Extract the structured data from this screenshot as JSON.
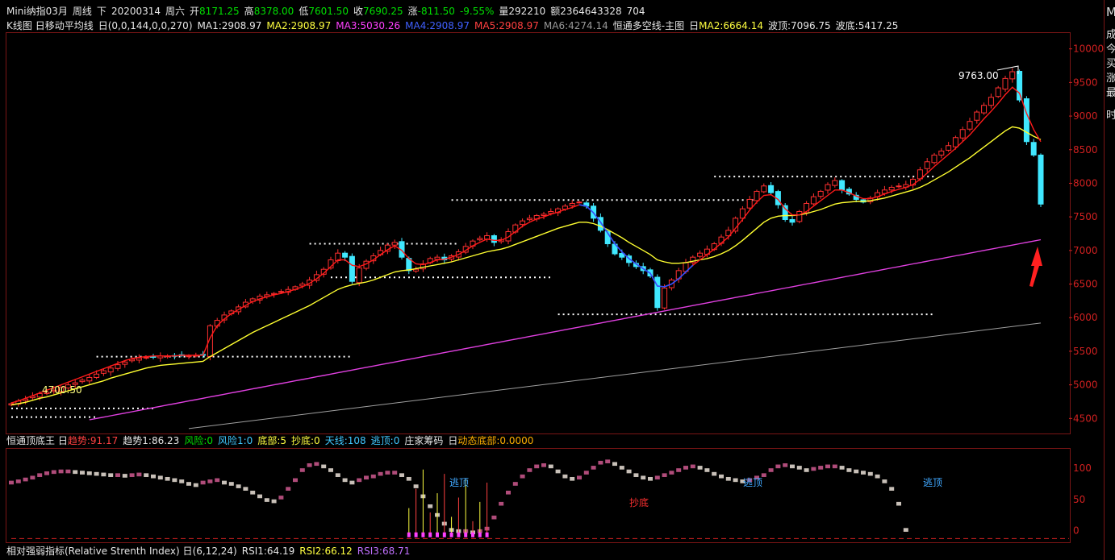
{
  "header": {
    "symbol": "Mini纳指03月",
    "period": "周线",
    "direction": "下",
    "date": "20200314",
    "weekday": "周六",
    "open_label": "开",
    "open": "8171.25",
    "high_label": "高",
    "high": "8378.00",
    "low_label": "低",
    "low": "7601.50",
    "close_label": "收",
    "close": "7690.25",
    "chg_label": "涨",
    "chg": "-811.50",
    "chg_pct": "-9.55%",
    "vol_label": "量",
    "vol": "292210",
    "amt_label": "额",
    "amt": "2364643328",
    "extra": "704"
  },
  "ma_bar": {
    "k_label": "K线图",
    "ma_name": "日移动平均线",
    "ma_params": "日(0,0,144,0,0,270)",
    "ma1": "MA1:2908.97",
    "ma2": "MA2:2908.97",
    "ma3": "MA3:5030.26",
    "ma4": "MA4:2908.97",
    "ma5": "MA5:2908.97",
    "ma6": "MA6:4274.14",
    "hengtong": "恒通多空线-主图",
    "hengtong_box": "日",
    "ma2b": "MA2:6664.14",
    "bo_top": "波顶:7096.75",
    "bo_bottom": "波底:5417.25"
  },
  "ind_bar": {
    "name": "恒通顶底王",
    "box": "日",
    "trend": "趋势:91.17",
    "trend1": "趋势1:86.23",
    "risk": "风险:0",
    "risk1": "风险1:0",
    "bottom": "底部:5",
    "chaodi": "抄底:0",
    "tianxian": "天线:108",
    "taoding": "逃顶:0",
    "zhuangjia": "庄家筹码",
    "zj_box": "日",
    "dongtai": "动态底部:0.0000"
  },
  "rsi_bar": {
    "name": "相对强弱指标(Relative Strenth Index)",
    "box": "日",
    "params": "(6,12,24)",
    "rsi1": "RSI1:64.19",
    "rsi2": "RSI2:66.12",
    "rsi3": "RSI3:68.71"
  },
  "right_panel": {
    "c0": "M",
    "c1": "成",
    "c2": "今",
    "c3": "买",
    "c4": "涨",
    "c5": "最",
    "c6": "时"
  },
  "annotations": {
    "peak": "9763.00",
    "start": "4700.50",
    "taoding1": "逃顶",
    "taoding2": "逃顶",
    "taoding3": "逃顶",
    "chaodi_text": "抄底"
  },
  "colors": {
    "up": "#ff3030",
    "down": "#40e8ff",
    "ma_red": "#ff1a1a",
    "ma_yellow": "#ffff30",
    "ma_magenta": "#e040e0",
    "ma_gray": "#a0a0a0",
    "ma_green": "#30e030",
    "ma_blue": "#3050ff"
  },
  "chart_data": {
    "type": "candlestick",
    "y_axis_ticks": [
      10000,
      9500,
      9000,
      8500,
      8000,
      7500,
      7000,
      6500,
      6000,
      5500,
      5000,
      4500
    ],
    "ylim": [
      4300,
      10200
    ],
    "ind_ticks": [
      100,
      50,
      0
    ],
    "ind_ylim": [
      -15,
      130
    ],
    "weeks": 130,
    "close": [
      4720,
      4760,
      4790,
      4830,
      4870,
      4890,
      4920,
      4960,
      5000,
      5030,
      5070,
      5110,
      5160,
      5210,
      5250,
      5300,
      5340,
      5380,
      5400,
      5410,
      5420,
      5430,
      5430,
      5430,
      5440,
      5430,
      5440,
      5440,
      5880,
      5960,
      6040,
      6100,
      6160,
      6230,
      6280,
      6320,
      6340,
      6360,
      6390,
      6420,
      6460,
      6500,
      6560,
      6640,
      6720,
      6860,
      6960,
      6900,
      6540,
      6740,
      6840,
      6920,
      7000,
      7080,
      7120,
      6900,
      6700,
      6720,
      6800,
      6880,
      6900,
      6860,
      6920,
      6980,
      7060,
      7140,
      7180,
      7220,
      7120,
      7160,
      7280,
      7380,
      7440,
      7480,
      7520,
      7540,
      7580,
      7620,
      7660,
      7700,
      7720,
      7660,
      7480,
      7300,
      7100,
      6950,
      6900,
      6820,
      6760,
      6700,
      6620,
      6150,
      6440,
      6560,
      6700,
      6820,
      6900,
      6960,
      7020,
      7100,
      7200,
      7300,
      7480,
      7620,
      7760,
      7880,
      7960,
      7860,
      7680,
      7460,
      7420,
      7580,
      7700,
      7800,
      7880,
      7980,
      8040,
      7900,
      7840,
      7760,
      7720,
      7780,
      7860,
      7900,
      7940,
      7960,
      7980,
      8060,
      8200,
      8320,
      8420,
      8480,
      8560,
      8680,
      8800,
      8920,
      9060,
      9160,
      9280,
      9420,
      9560,
      9660,
      9240,
      8620,
      8420,
      7690
    ],
    "ma_red": [
      4730,
      4760,
      4800,
      4840,
      4880,
      4920,
      4960,
      5000,
      5040,
      5080,
      5120,
      5160,
      5200,
      5240,
      5280,
      5320,
      5360,
      5390,
      5410,
      5420,
      5430,
      5430,
      5430,
      5430,
      5440,
      5440,
      5440,
      5440,
      5700,
      5880,
      5980,
      6060,
      6120,
      6180,
      6240,
      6280,
      6310,
      6340,
      6360,
      6390,
      6420,
      6460,
      6510,
      6580,
      6660,
      6760,
      6860,
      6860,
      6780,
      6760,
      6800,
      6860,
      6940,
      7010,
      7070,
      7000,
      6880,
      6800,
      6790,
      6820,
      6860,
      6870,
      6900,
      6940,
      7000,
      7070,
      7120,
      7170,
      7150,
      7150,
      7200,
      7280,
      7360,
      7420,
      7470,
      7500,
      7540,
      7570,
      7610,
      7640,
      7680,
      7660,
      7560,
      7420,
      7260,
      7100,
      6980,
      6880,
      6800,
      6730,
      6660,
      6470,
      6460,
      6500,
      6580,
      6680,
      6780,
      6860,
      6940,
      7020,
      7110,
      7200,
      7330,
      7460,
      7600,
      7720,
      7820,
      7830,
      7760,
      7620,
      7530,
      7530,
      7580,
      7660,
      7740,
      7820,
      7900,
      7900,
      7860,
      7810,
      7770,
      7770,
      7800,
      7840,
      7880,
      7910,
      7940,
      7980,
      8060,
      8150,
      8250,
      8340,
      8430,
      8520,
      8620,
      8720,
      8840,
      8960,
      9070,
      9190,
      9320,
      9430,
      9340,
      9040,
      8800,
      8620
    ],
    "ma_yellow": [
      4700,
      4720,
      4740,
      4770,
      4800,
      4820,
      4850,
      4880,
      4910,
      4940,
      4970,
      5000,
      5030,
      5060,
      5100,
      5130,
      5160,
      5190,
      5220,
      5250,
      5270,
      5290,
      5300,
      5310,
      5320,
      5330,
      5340,
      5350,
      5420,
      5480,
      5540,
      5600,
      5660,
      5720,
      5780,
      5830,
      5880,
      5930,
      5980,
      6030,
      6080,
      6130,
      6180,
      6240,
      6300,
      6360,
      6420,
      6460,
      6490,
      6510,
      6530,
      6560,
      6600,
      6640,
      6680,
      6700,
      6710,
      6730,
      6750,
      6770,
      6790,
      6810,
      6830,
      6860,
      6890,
      6920,
      6950,
      6980,
      7000,
      7020,
      7050,
      7090,
      7130,
      7170,
      7210,
      7250,
      7290,
      7330,
      7360,
      7390,
      7420,
      7420,
      7400,
      7360,
      7310,
      7250,
      7190,
      7120,
      7060,
      7000,
      6940,
      6860,
      6830,
      6810,
      6810,
      6820,
      6840,
      6860,
      6880,
      6910,
      6950,
      7000,
      7070,
      7150,
      7240,
      7330,
      7420,
      7480,
      7510,
      7520,
      7520,
      7530,
      7550,
      7580,
      7610,
      7650,
      7690,
      7710,
      7720,
      7730,
      7730,
      7740,
      7760,
      7780,
      7810,
      7840,
      7870,
      7900,
      7940,
      7990,
      8050,
      8110,
      8170,
      8240,
      8310,
      8380,
      8460,
      8540,
      8620,
      8700,
      8780,
      8840,
      8820,
      8760,
      8700,
      8650
    ],
    "ma_magenta": [
      4480,
      4500,
      4520,
      4540,
      4560,
      4580,
      4600,
      4620,
      4640,
      4660,
      4680,
      4700,
      4720,
      4740,
      4760,
      4780,
      4800,
      4820,
      4840,
      4860,
      4880,
      4900,
      4920,
      4940,
      4960,
      4980,
      5000,
      5020,
      5040,
      5060,
      5080,
      5100,
      5120,
      5140,
      5160,
      5180,
      5200,
      5220,
      5240,
      5260,
      5280,
      5300,
      5320,
      5340,
      5360,
      5380,
      5400,
      5420,
      5440,
      5460,
      5480,
      5500,
      5520,
      5540,
      5560,
      5580,
      5600,
      5620,
      5640,
      5660,
      5680,
      5700,
      5720,
      5740,
      5760,
      5780,
      5800,
      5820,
      5840,
      5860,
      5880,
      5900,
      5920,
      5940,
      5960,
      5980,
      6000,
      6020,
      6040,
      6060,
      6080,
      6100,
      6120,
      6140,
      6160,
      6180,
      6200,
      6220,
      6240,
      6260,
      6280,
      6300,
      6320,
      6340,
      6360,
      6380,
      6400,
      6420,
      6440,
      6460,
      6480,
      6500,
      6520,
      6540,
      6560,
      6580,
      6600,
      6620,
      6640,
      6660,
      6680,
      6700,
      6720,
      6740,
      6760,
      6780,
      6800,
      6820,
      6840,
      6860,
      6880,
      6900,
      6920,
      6940,
      6960,
      6980,
      7000,
      7020,
      7040,
      7060,
      7080,
      7100,
      7120,
      7140,
      7160
    ],
    "ma_gray_start": 4350,
    "ma_gray_end": 5920,
    "levels": [
      {
        "value": 8100,
        "from": 99,
        "to": 130
      },
      {
        "value": 7750,
        "from": 62,
        "to": 105
      },
      {
        "value": 7100,
        "from": 42,
        "to": 63
      },
      {
        "value": 6600,
        "from": 45,
        "to": 76
      },
      {
        "value": 6050,
        "from": 77,
        "to": 130
      },
      {
        "value": 5420,
        "from": 12,
        "to": 48
      },
      {
        "value": 4650,
        "from": 0,
        "to": 20
      },
      {
        "value": 4520,
        "from": 0,
        "to": 12
      }
    ],
    "indicator": [
      80,
      82,
      85,
      88,
      92,
      95,
      97,
      98,
      98,
      97,
      96,
      95,
      94,
      93,
      92,
      92,
      91,
      92,
      93,
      92,
      90,
      88,
      86,
      84,
      82,
      78,
      76,
      80,
      82,
      84,
      80,
      78,
      74,
      70,
      64,
      58,
      52,
      50,
      56,
      70,
      84,
      100,
      108,
      110,
      106,
      100,
      92,
      84,
      80,
      84,
      88,
      90,
      94,
      96,
      96,
      92,
      86,
      74,
      58,
      42,
      28,
      14,
      4,
      2,
      2,
      0,
      2,
      6,
      24,
      46,
      64,
      78,
      90,
      100,
      106,
      108,
      106,
      98,
      90,
      86,
      88,
      96,
      104,
      112,
      114,
      110,
      104,
      98,
      92,
      88,
      86,
      88,
      92,
      96,
      100,
      104,
      106,
      104,
      100,
      94,
      90,
      86,
      84,
      82,
      84,
      88,
      92,
      100,
      106,
      108,
      106,
      104,
      100,
      102,
      104,
      106,
      106,
      104,
      100,
      98,
      96,
      94,
      90,
      82,
      70,
      46,
      4
    ]
  }
}
